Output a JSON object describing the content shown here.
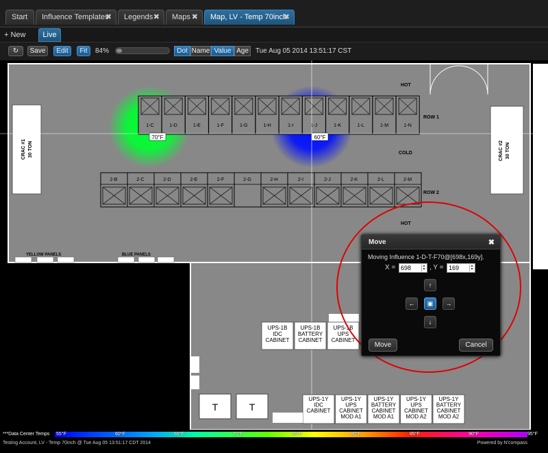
{
  "tabs": [
    {
      "label": "Start",
      "closable": false
    },
    {
      "label": "Influence Templates",
      "closable": true
    },
    {
      "label": "Legends",
      "closable": true
    },
    {
      "label": "Maps",
      "closable": true
    },
    {
      "label": "Map, LV - Temp 70inch",
      "closable": true,
      "active": true
    }
  ],
  "subnav": {
    "new_label": "+ New",
    "live_label": "Live"
  },
  "toolbar": {
    "save_label": "Save",
    "edit_label": "Edit",
    "fit_label": "Fit",
    "zoom": "84%",
    "zoom_fraction": 0.0,
    "display_modes": [
      {
        "label": "Dot",
        "on": true
      },
      {
        "label": "Name",
        "on": false
      },
      {
        "label": "Value",
        "on": true
      },
      {
        "label": "Age",
        "on": false
      }
    ],
    "timestamp": "Tue Aug 05 2014 13:51:17 CST"
  },
  "map": {
    "row1_label": "ROW 1",
    "row2_label": "ROW 2",
    "hot_label": "HOT",
    "cold_label": "COLD",
    "hot_label_2": "HOT",
    "crac1": [
      "CRAC #1",
      "30 TON"
    ],
    "crac2": [
      "CRAC #2",
      "30 TON"
    ],
    "row1_racks": [
      "1-C",
      "1-D",
      "1-E",
      "1-F",
      "1-G",
      "1-H",
      "1-I",
      "1-J",
      "1-K",
      "1-L",
      "1-M",
      "1-N"
    ],
    "row2_racks": [
      "2-B",
      "2-C",
      "2-D",
      "2-E",
      "2-F",
      "2-G",
      "2-H",
      "2-I",
      "2-J",
      "2-K",
      "2-L",
      "2-M"
    ],
    "yellow_panels": "YELLOW PANELS",
    "blue_panels": "BLUE PANELS",
    "ups_cabinets_top": [
      [
        "UPS-1B",
        "IDC",
        "CABINET"
      ],
      [
        "UPS-1B",
        "BATTERY",
        "CABINET"
      ],
      [
        "UPS-1B",
        "UPS",
        "CABINET"
      ]
    ],
    "ups_cabinets_bottom": [
      [
        "UPS-1Y",
        "IDC",
        "CABINET"
      ],
      [
        "UPS-1Y",
        "UPS",
        "CABINET",
        "MOD A1"
      ],
      [
        "UPS-1Y",
        "BATTERY",
        "CABINET",
        "MOD A1"
      ],
      [
        "UPS-1Y",
        "UPS",
        "CABINET",
        "MOD A2"
      ],
      [
        "UPS-1Y",
        "BATTERY",
        "CABINET",
        "MOD A2"
      ]
    ],
    "transformers": [
      "T",
      "T"
    ],
    "influences": [
      {
        "label": "70°F",
        "color": "#00ff30"
      },
      {
        "label": "60°F",
        "color": "#0010ff"
      }
    ]
  },
  "legend": {
    "name": "***Data Center Temps",
    "ticks": [
      "55°F",
      "60°F",
      "65°F",
      "70°F",
      "75°F",
      "80°F",
      "85°F",
      "90°F",
      "95°F"
    ],
    "status": "Testing Account, LV - Temp 70inch @ Tue Aug 05 13:51:17 CDT 2014",
    "powered_by": "Powered by N'compass"
  },
  "dialog": {
    "title": "Move",
    "close": "✖",
    "message": "Moving Influence 1-D-T-F70@[698x,169y].",
    "x_label": "X =",
    "x_value": "698",
    "y_label": ", Y =",
    "y_value": "169",
    "move_label": "Move",
    "cancel_label": "Cancel"
  },
  "colors": {
    "accent": "#1d6ea8",
    "annotation_circle": "#e00000"
  }
}
